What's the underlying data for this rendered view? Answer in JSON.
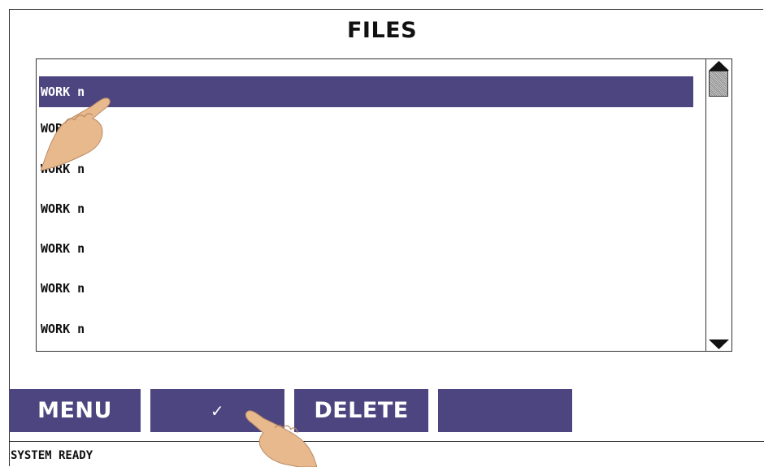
{
  "header": {
    "title": "FILES"
  },
  "file_list": {
    "items": [
      {
        "label": "WORK n",
        "selected": true
      },
      {
        "label": "WORK n",
        "selected": false
      },
      {
        "label": "WORK n",
        "selected": false
      },
      {
        "label": "WORK n",
        "selected": false
      },
      {
        "label": "WORK n",
        "selected": false
      },
      {
        "label": "WORK n",
        "selected": false
      },
      {
        "label": "WORK n",
        "selected": false
      }
    ]
  },
  "toolbar": {
    "menu_label": "MENU",
    "confirm_label": "✓",
    "delete_label": "DELETE",
    "blank_label": ""
  },
  "status": {
    "text": "SYSTEM READY"
  },
  "colors": {
    "accent": "#4c4580",
    "background": "#ffffff",
    "text": "#111111",
    "hand_skin": "#e9b98e"
  },
  "icons": {
    "scroll_up": "triangle-up-icon",
    "scroll_down": "triangle-down-icon",
    "pointer_hand": "pointer-hand-icon"
  }
}
